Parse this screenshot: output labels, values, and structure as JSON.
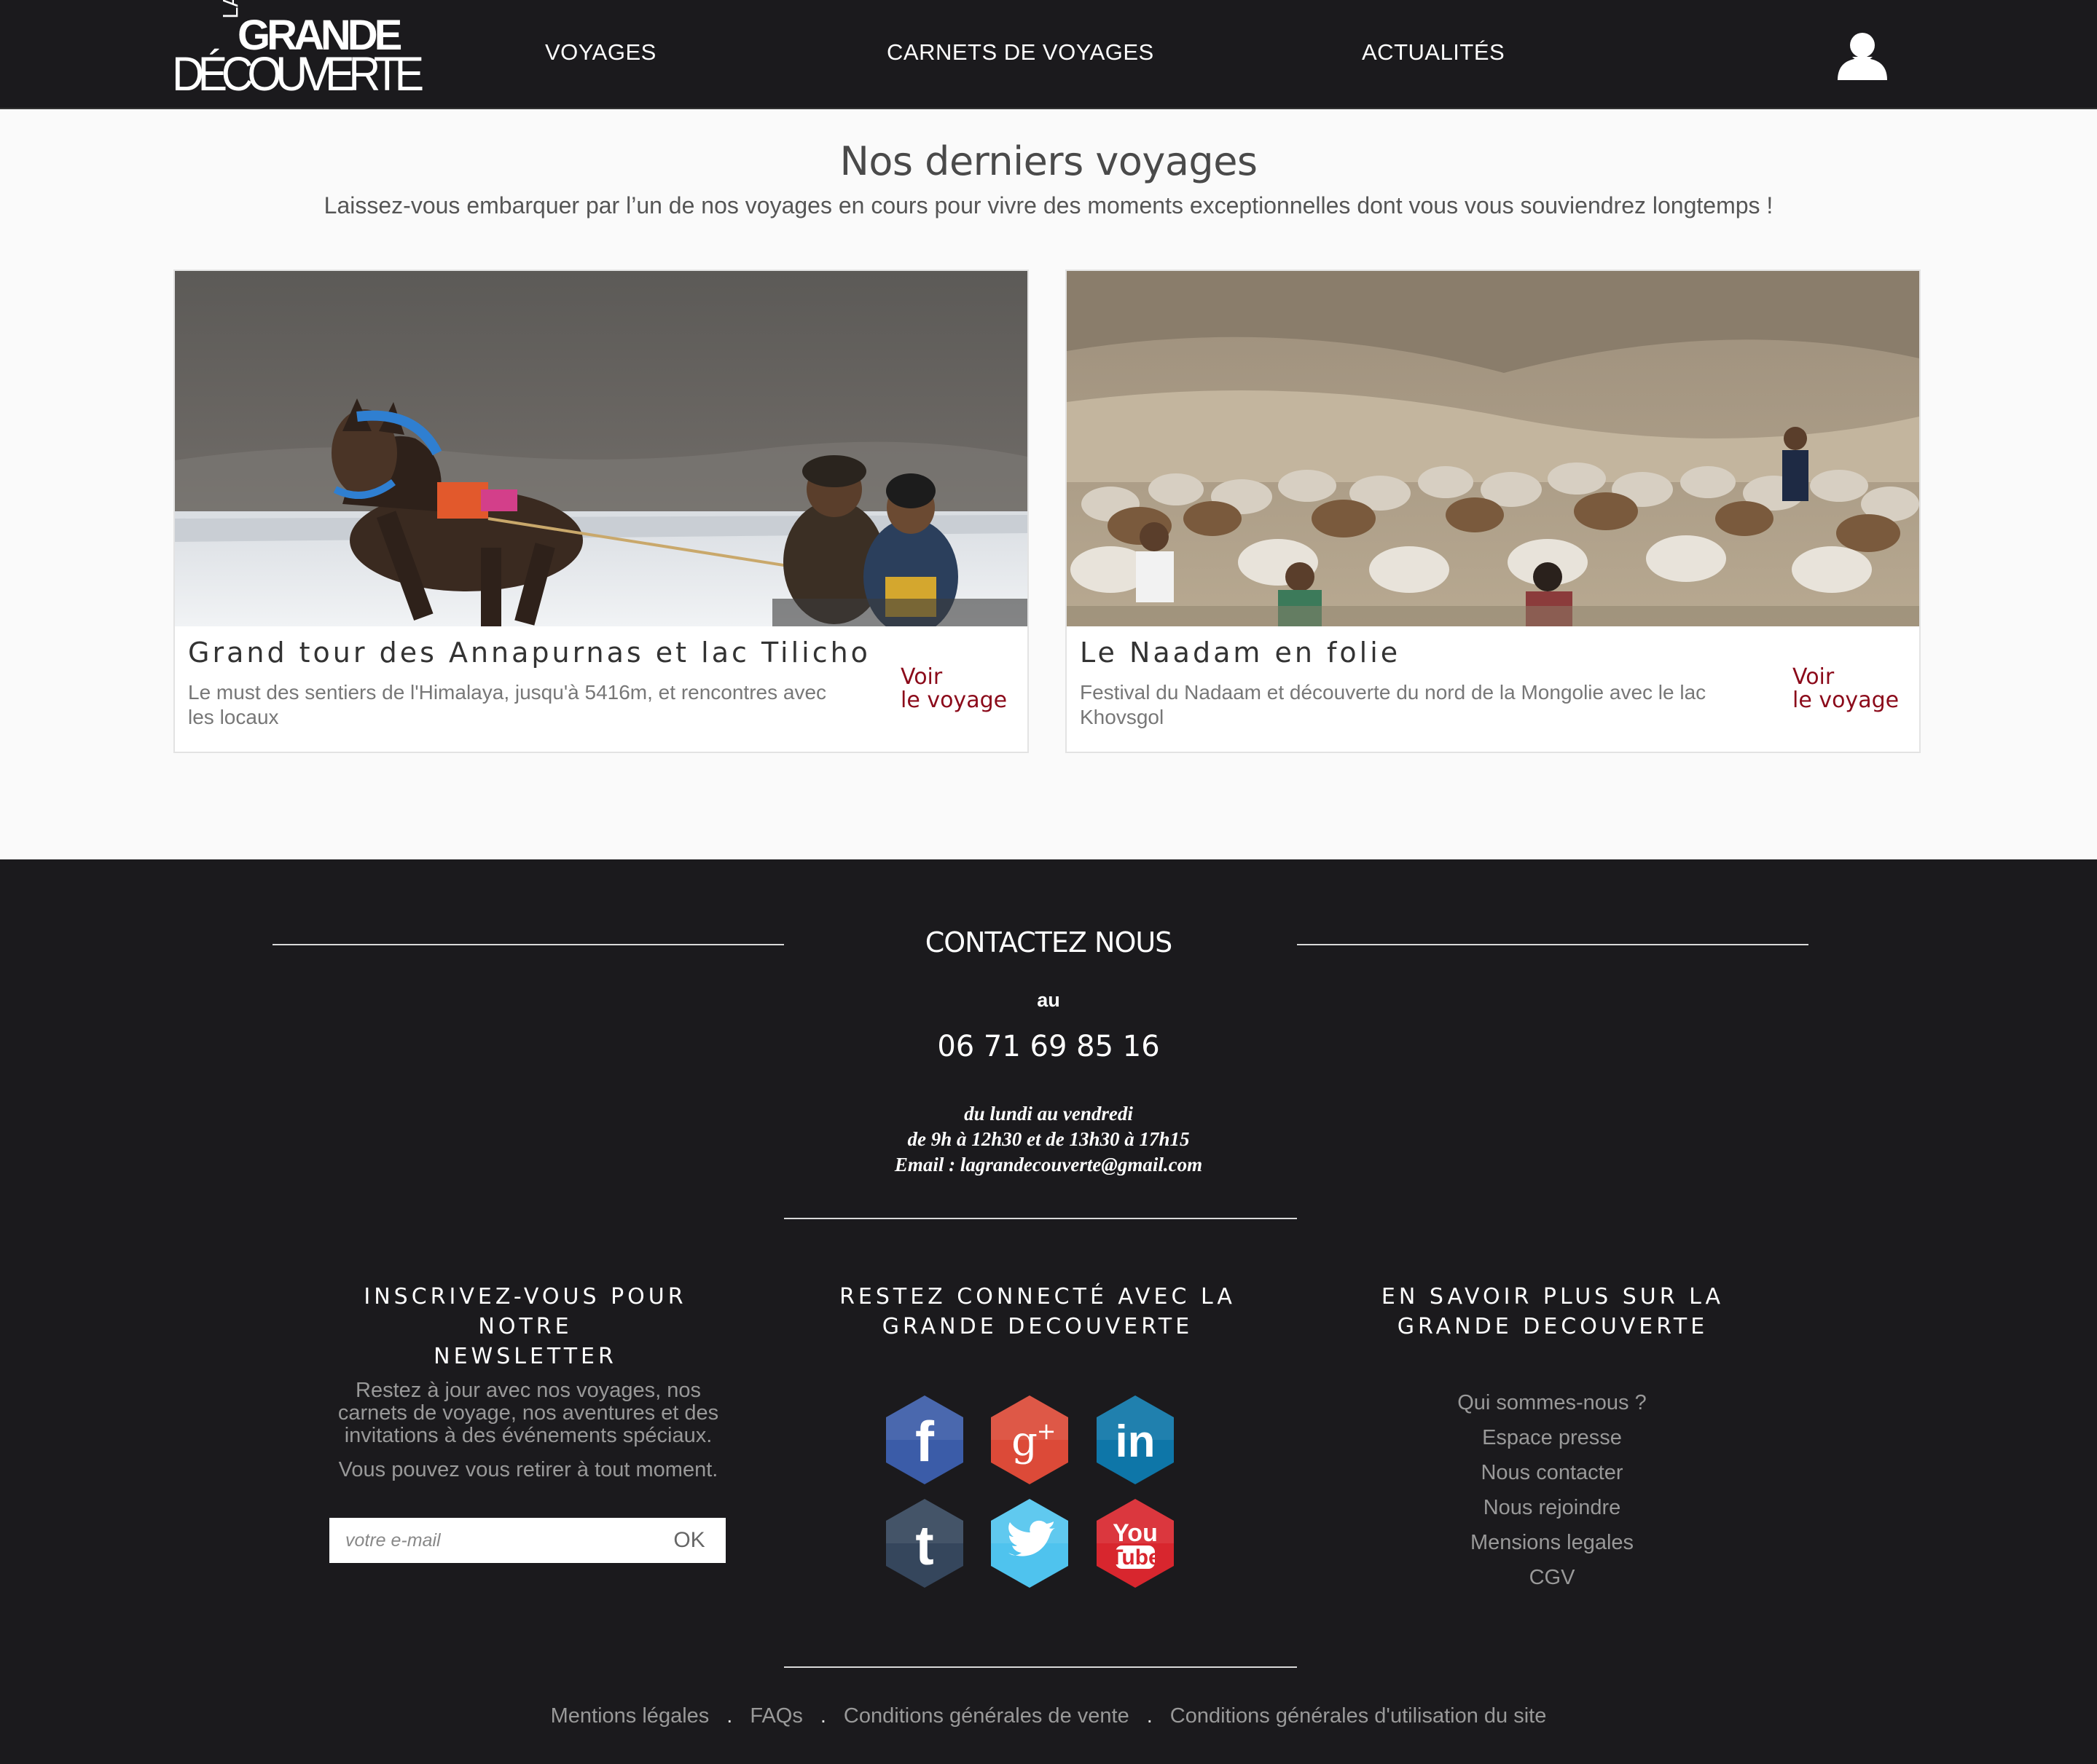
{
  "logo": {
    "la": "LA",
    "grande": "GRANDE",
    "decouverte": "DÉCOUVERTE"
  },
  "nav": {
    "voyages": "VOYAGES",
    "carnets": "CARNETS DE VOYAGES",
    "actualites": "ACTUALITÉS"
  },
  "main": {
    "title": "Nos derniers voyages",
    "subtitle": "Laissez-vous embarquer par l’un de nos voyages en cours pour vivre des moments exceptionnelles dont vous vous souviendrez longtemps !"
  },
  "cards": [
    {
      "title": "Grand tour des Annapurnas et lac Tilicho",
      "description": "Le must des sentiers de l'Himalaya, jusqu'à 5416m, et rencontres avec les locaux",
      "link_line1": "Voir",
      "link_line2": "le voyage"
    },
    {
      "title": "Le Naadam en folie",
      "description": "Festival du Nadaam et découverte du nord de la Mongolie avec le lac Khovsgol",
      "link_line1": "Voir",
      "link_line2": "le voyage"
    }
  ],
  "contact": {
    "title": "CONTACTEZ NOUS",
    "au": "au",
    "phone": "06 71 69 85 16",
    "days": "du lundi au vendredi",
    "hours": "de 9h à 12h30 et de 13h30 à 17h15",
    "email": "Email : lagrandecouverte@gmail.com"
  },
  "newsletter": {
    "title_line1": "INSCRIVEZ-VOUS POUR NOTRE",
    "title_line2": "NEWSLETTER",
    "text_line1": "Restez à jour avec nos voyages, nos",
    "text_line2": "carnets de voyage, nos aventures et des",
    "text_line3": "invitations à des événements spéciaux.",
    "text2": "Vous pouvez vous retirer à tout moment.",
    "placeholder": "votre e-mail",
    "button": "OK"
  },
  "social": {
    "title_line1": "RESTEZ CONNECTÉ AVEC LA",
    "title_line2": "GRANDE DECOUVERTE",
    "networks": [
      "facebook",
      "google-plus",
      "linkedin",
      "tumblr",
      "twitter",
      "youtube"
    ],
    "colors": {
      "facebook": "#3b5ca8",
      "google": "#dc4a38",
      "linkedin": "#0e76a8",
      "tumblr": "#35465c",
      "twitter": "#4fc3ee",
      "youtube": "#d8262e"
    }
  },
  "more": {
    "title_line1": "EN SAVOIR PLUS SUR LA",
    "title_line2": "GRANDE DECOUVERTE",
    "links": [
      "Qui sommes-nous ?",
      "Espace presse",
      "Nous contacter",
      "Nous rejoindre",
      "Mensions legales",
      "CGV"
    ]
  },
  "bottom": {
    "links": [
      "Mentions légales",
      "FAQs",
      "Conditions générales de vente",
      "Conditions générales d'utilisation du site"
    ],
    "separator": "."
  },
  "colors": {
    "header_bg": "#1b1a1d",
    "footer_bg": "#1b1a1d",
    "accent": "#8b0a1a",
    "page_bg": "#fafafa"
  }
}
